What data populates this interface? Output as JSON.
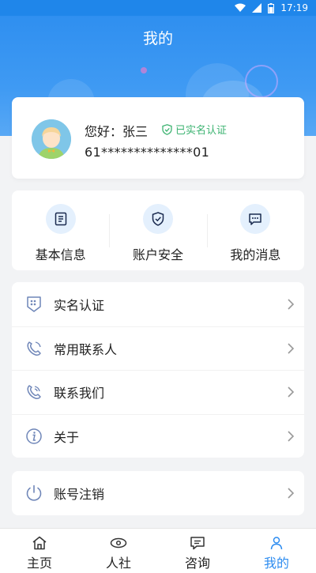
{
  "status_bar": {
    "time": "17:19"
  },
  "header": {
    "title": "我的"
  },
  "profile": {
    "greeting": "您好：张三",
    "verified_label": "已实名认证",
    "account_masked": "61**************01"
  },
  "quick_actions": [
    {
      "label": "基本信息",
      "icon": "document-icon"
    },
    {
      "label": "账户安全",
      "icon": "shield-icon"
    },
    {
      "label": "我的消息",
      "icon": "message-icon"
    }
  ],
  "menu": [
    {
      "label": "实名认证",
      "icon": "id-verify-icon"
    },
    {
      "label": "常用联系人",
      "icon": "contacts-icon"
    },
    {
      "label": "联系我们",
      "icon": "phone-icon"
    },
    {
      "label": "关于",
      "icon": "info-icon"
    }
  ],
  "logout": {
    "label": "账号注销",
    "icon": "power-icon"
  },
  "bottom_nav": [
    {
      "label": "主页",
      "icon": "home-icon",
      "active": false
    },
    {
      "label": "人社",
      "icon": "eye-icon",
      "active": false
    },
    {
      "label": "咨询",
      "icon": "chat-icon",
      "active": false
    },
    {
      "label": "我的",
      "icon": "person-icon",
      "active": true
    }
  ],
  "colors": {
    "primary": "#2d8cf0",
    "verified": "#3cb371",
    "background": "#f2f3f5"
  }
}
